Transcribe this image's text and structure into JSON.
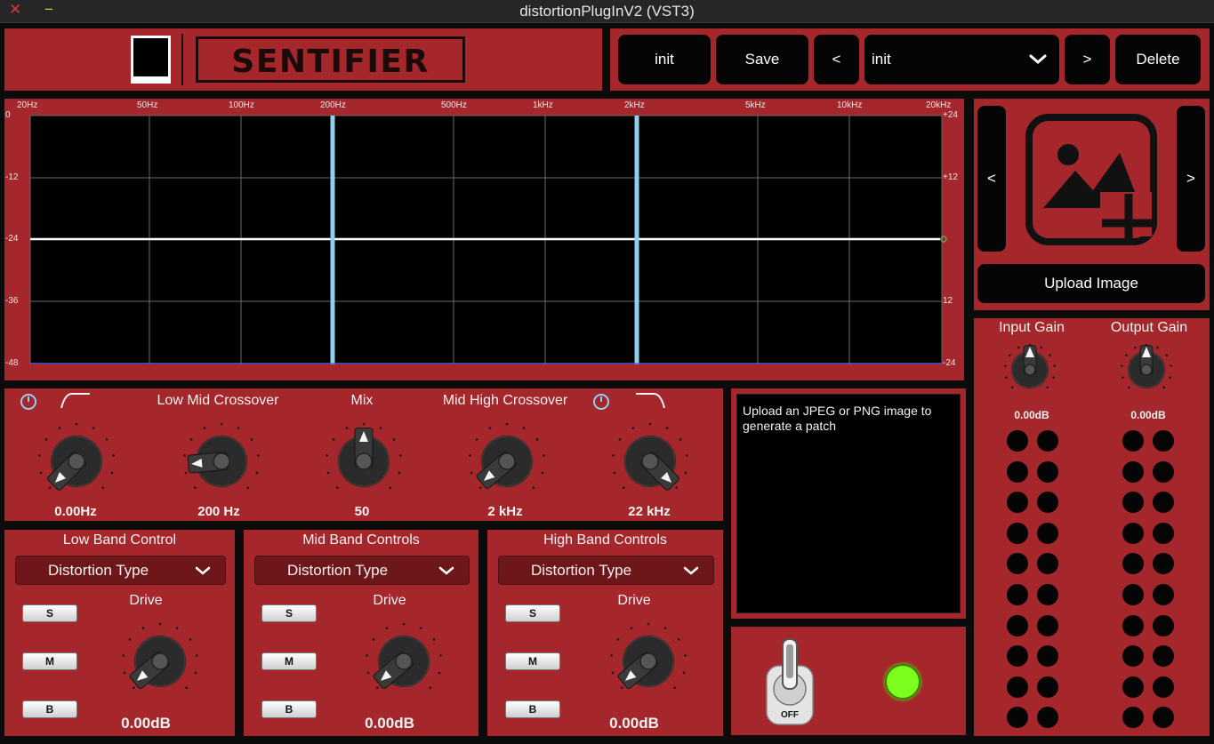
{
  "window": {
    "title": "distortionPlugInV2 (VST3)"
  },
  "brand": {
    "name": "SENTIFIER"
  },
  "presets": {
    "init_label": "init",
    "save_label": "Save",
    "prev_label": "<",
    "selected": "init",
    "next_label": ">",
    "delete_label": "Delete"
  },
  "graph": {
    "freq_labels": [
      "20Hz",
      "50Hz",
      "100Hz",
      "200Hz",
      "500Hz",
      "1kHz",
      "2kHz",
      "5kHz",
      "10kHz",
      "20kHz"
    ],
    "left_db_labels": [
      "0",
      "-12",
      "-24",
      "-36",
      "-48"
    ],
    "right_db_labels": [
      "+24",
      "+12",
      "",
      "12",
      "-24"
    ],
    "crossovers": [
      "200 Hz",
      "2 kHz"
    ],
    "line_color": "#ffffff",
    "crossover_color": "#8fd0ee"
  },
  "crossover": {
    "low_cut_value": "0.00Hz",
    "low_mid_label": "Low Mid Crossover",
    "low_mid_value": "200 Hz",
    "mix_label": "Mix",
    "mix_value": "50",
    "mid_high_label": "Mid High Crossover",
    "mid_high_value": "2 kHz",
    "high_cut_value": "22 kHz"
  },
  "image": {
    "prev_label": "<",
    "next_label": ">",
    "upload_label": "Upload Image",
    "message": "Upload an JPEG or PNG image to generate a patch"
  },
  "gain": {
    "input_label": "Input Gain",
    "input_value": "0.00dB",
    "output_label": "Output Gain",
    "output_value": "0.00dB"
  },
  "bands": [
    {
      "title": "Low Band Control",
      "type_label": "Distortion Type",
      "s": "S",
      "m": "M",
      "b": "B",
      "drive_label": "Drive",
      "drive_value": "0.00dB"
    },
    {
      "title": "Mid Band Controls",
      "type_label": "Distortion Type",
      "s": "S",
      "m": "M",
      "b": "B",
      "drive_label": "Drive",
      "drive_value": "0.00dB"
    },
    {
      "title": "High Band Controls",
      "type_label": "Distortion Type",
      "s": "S",
      "m": "M",
      "b": "B",
      "drive_label": "Drive",
      "drive_value": "0.00dB"
    }
  ],
  "power": {
    "switch_label": "OFF",
    "led_color": "#7dff1e"
  },
  "colors": {
    "panel": "#a5262b",
    "accent": "#8fd0ee"
  }
}
